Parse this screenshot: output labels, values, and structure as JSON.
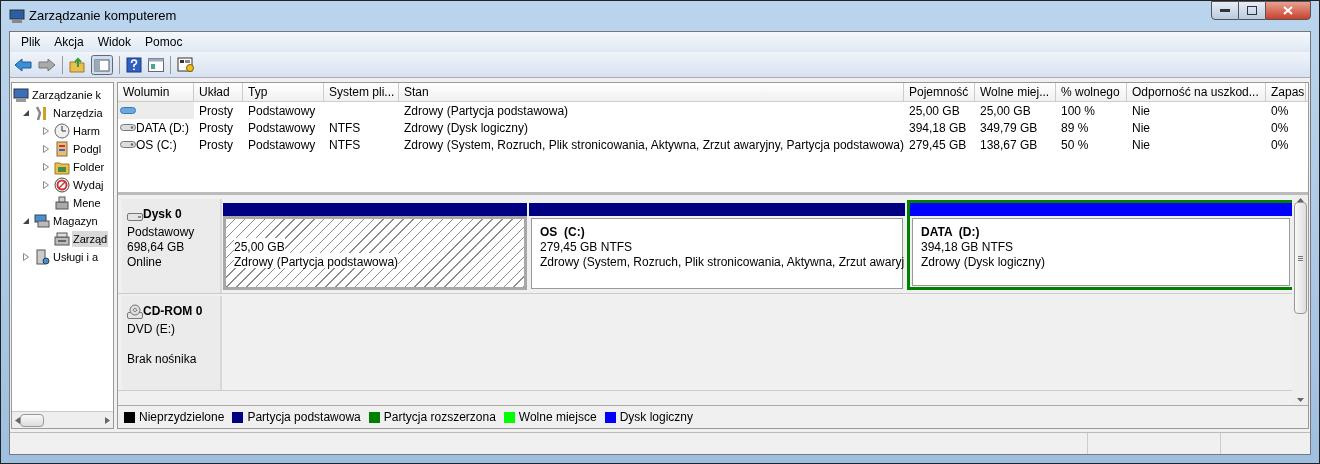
{
  "window": {
    "title": "Zarządzanie komputerem"
  },
  "menu": [
    "Plik",
    "Akcja",
    "Widok",
    "Pomoc"
  ],
  "tree": [
    {
      "label": "Zarządzanie k",
      "selected": false,
      "children": [
        {
          "label": "Narzędzia",
          "expanded": true,
          "selected": false,
          "children": [
            {
              "label": "Harm",
              "expanded": false,
              "selected": false
            },
            {
              "label": "Podgl",
              "expanded": false,
              "selected": false
            },
            {
              "label": "Folder",
              "expanded": false,
              "selected": false
            },
            {
              "label": "Wydaj",
              "expanded": false,
              "selected": false
            },
            {
              "label": "Mene",
              "selected": false
            }
          ]
        },
        {
          "label": "Magazyn",
          "expanded": true,
          "selected": false,
          "children": [
            {
              "label": "Zarząd",
              "selected": true
            }
          ]
        },
        {
          "label": "Usługi i a",
          "expanded": false,
          "selected": false
        }
      ]
    }
  ],
  "table": {
    "columns": [
      "Wolumin",
      "Układ",
      "Typ",
      "System pli...",
      "Stan",
      "Pojemność",
      "Wolne miej...",
      "% wolnego",
      "Odporność na uszkod...",
      "Zapas"
    ],
    "rows": [
      {
        "selected": true,
        "cells": [
          "",
          "Prosty",
          "Podstawowy",
          "",
          "Zdrowy (Partycja podstawowa)",
          "25,00 GB",
          "25,00 GB",
          "100 %",
          "Nie",
          "0%"
        ]
      },
      {
        "selected": false,
        "cells": [
          "DATA (D:)",
          "Prosty",
          "Podstawowy",
          "NTFS",
          "Zdrowy (Dysk logiczny)",
          "394,18 GB",
          "349,79 GB",
          "89 %",
          "Nie",
          "0%"
        ]
      },
      {
        "selected": false,
        "cells": [
          "OS (C:)",
          "Prosty",
          "Podstawowy",
          "NTFS",
          "Zdrowy (System, Rozruch, Plik stronicowania, Aktywna, Zrzut awaryjny, Partycja podstawowa)",
          "279,45 GB",
          "138,67 GB",
          "50 %",
          "Nie",
          "0%"
        ]
      }
    ]
  },
  "disks": [
    {
      "kind": "disk",
      "name": "Dysk 0",
      "lines": [
        "Podstawowy",
        "698,64 GB",
        "Online"
      ],
      "partitions": [
        {
          "kind": "primary",
          "selected": true,
          "size": "25,00 GB",
          "status": "Zdrowy (Partycja podstawowa)"
        },
        {
          "kind": "primary",
          "selected": false,
          "title": "OS  (C:)",
          "size": "279,45 GB NTFS",
          "status": "Zdrowy (System, Rozruch, Plik stronicowania, Aktywna, Zrzut awaryj"
        },
        {
          "kind": "logical",
          "selected": false,
          "title": "DATA  (D:)",
          "size": "394,18 GB NTFS",
          "status": "Zdrowy (Dysk logiczny)"
        }
      ]
    },
    {
      "kind": "cdrom",
      "name": "CD-ROM 0",
      "lines": [
        "DVD (E:)"
      ],
      "note": "Brak nośnika"
    }
  ],
  "legend": [
    {
      "label": "Nieprzydzielone",
      "color": "#000000"
    },
    {
      "label": "Partycja podstawowa",
      "color": "#000080"
    },
    {
      "label": "Partycja rozszerzona",
      "color": "#008000"
    },
    {
      "label": "Wolne miejsce",
      "color": "#00ff00"
    },
    {
      "label": "Dysk logiczny",
      "color": "#0000ff"
    }
  ]
}
